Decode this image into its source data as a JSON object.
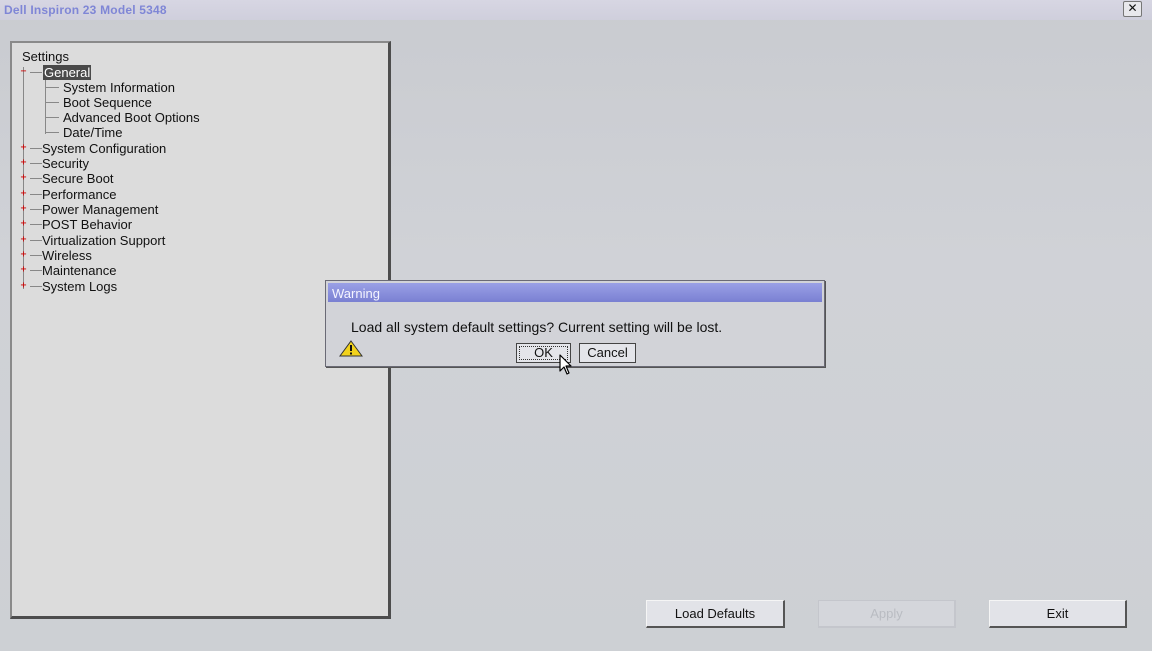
{
  "window": {
    "title": "Dell Inspiron 23 Model 5348",
    "close_glyph": "✕"
  },
  "tree": {
    "root": "Settings",
    "items": [
      {
        "label": "General",
        "expander": "−",
        "selected": true
      },
      {
        "label": "System Information"
      },
      {
        "label": "Boot Sequence"
      },
      {
        "label": "Advanced Boot Options"
      },
      {
        "label": "Date/Time"
      },
      {
        "label": "System Configuration",
        "expander": "+"
      },
      {
        "label": "Security",
        "expander": "+"
      },
      {
        "label": "Secure Boot",
        "expander": "+"
      },
      {
        "label": "Performance",
        "expander": "+"
      },
      {
        "label": "Power Management",
        "expander": "+"
      },
      {
        "label": "POST Behavior",
        "expander": "+"
      },
      {
        "label": "Virtualization Support",
        "expander": "+"
      },
      {
        "label": "Wireless",
        "expander": "+"
      },
      {
        "label": "Maintenance",
        "expander": "+"
      },
      {
        "label": "System Logs",
        "expander": "+"
      }
    ]
  },
  "dialog": {
    "title": "Warning",
    "message": "Load all system default settings?  Current setting will be lost.",
    "icon": "warning-icon",
    "ok_label": "OK",
    "cancel_label": "Cancel"
  },
  "footer": {
    "load_defaults_label": "Load Defaults",
    "apply_label": "Apply",
    "exit_label": "Exit"
  },
  "colors": {
    "title_accent": "#7f86d6",
    "dialog_title_bar": "#8a90dc",
    "background": "#cdd0d4",
    "selection": "#4a4a4a"
  }
}
